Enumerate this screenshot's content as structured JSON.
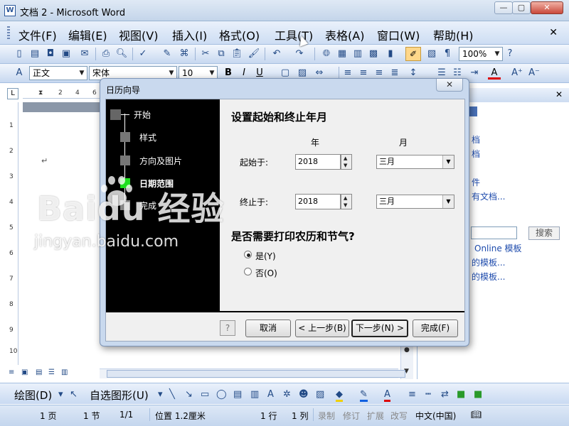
{
  "window": {
    "title": "文档 2 - Microsoft Word",
    "app_icon": "W",
    "min_icon": "—",
    "restore_icon": "▢",
    "close_icon": "✕"
  },
  "menu": {
    "items": [
      "文件(F)",
      "编辑(E)",
      "视图(V)",
      "插入(I)",
      "格式(O)",
      "工具(T)",
      "表格(A)",
      "窗口(W)",
      "帮助(H)"
    ],
    "close_icon": "✕"
  },
  "toolbar_standard": {
    "zoom": "100%"
  },
  "toolbar_format": {
    "style": "正文",
    "font": "宋体",
    "size": "10",
    "bold": "B",
    "italic": "I",
    "underline": "U",
    "font_color_label": "A"
  },
  "ruler": {
    "ticks": [
      "2",
      "4",
      "6"
    ],
    "vertical_numbers": [
      "1",
      "2",
      "3",
      "4",
      "5",
      "6",
      "7",
      "8",
      "9",
      "10"
    ]
  },
  "task_pane": {
    "close_icon": "✕",
    "links": [
      "档",
      "档",
      "件",
      "有文档...",
      "Online 模板",
      "的模板...",
      "的模板..."
    ],
    "search_label": "搜索"
  },
  "dialog": {
    "title": "日历向导",
    "close_icon": "✕",
    "steps": [
      "开始",
      "样式",
      "方向及图片",
      "日期范围",
      "完成"
    ],
    "current_step": 3,
    "heading_range": "设置起始和终止年月",
    "col_year": "年",
    "col_month": "月",
    "start_label": "起始于:",
    "start_year": "2018",
    "start_month": "三月",
    "end_label": "终止于:",
    "end_year": "2018",
    "end_month": "三月",
    "heading_lunar": "是否需要打印农历和节气?",
    "radio_yes": "是(Y)",
    "radio_no": "否(O)",
    "radio_selected": "yes",
    "buttons": {
      "cancel": "取消",
      "back": "< 上一步(B)",
      "next": "下一步(N) >",
      "finish": "完成(F)"
    }
  },
  "draw_toolbar": {
    "draw_label": "绘图(D)",
    "autoshape_label": "自选图形(U)"
  },
  "status_bar": {
    "page": "1 页",
    "section": "1 节",
    "page_of": "1/1",
    "position": "位置 1.2厘米",
    "line": "1 行",
    "column": "1 列",
    "rec": "录制",
    "trk": "修订",
    "ext": "扩展",
    "ovr": "改写",
    "language": "中文(中国)"
  },
  "watermark": {
    "brand": "Baidu 经验",
    "url": "jingyan.baidu.com"
  }
}
